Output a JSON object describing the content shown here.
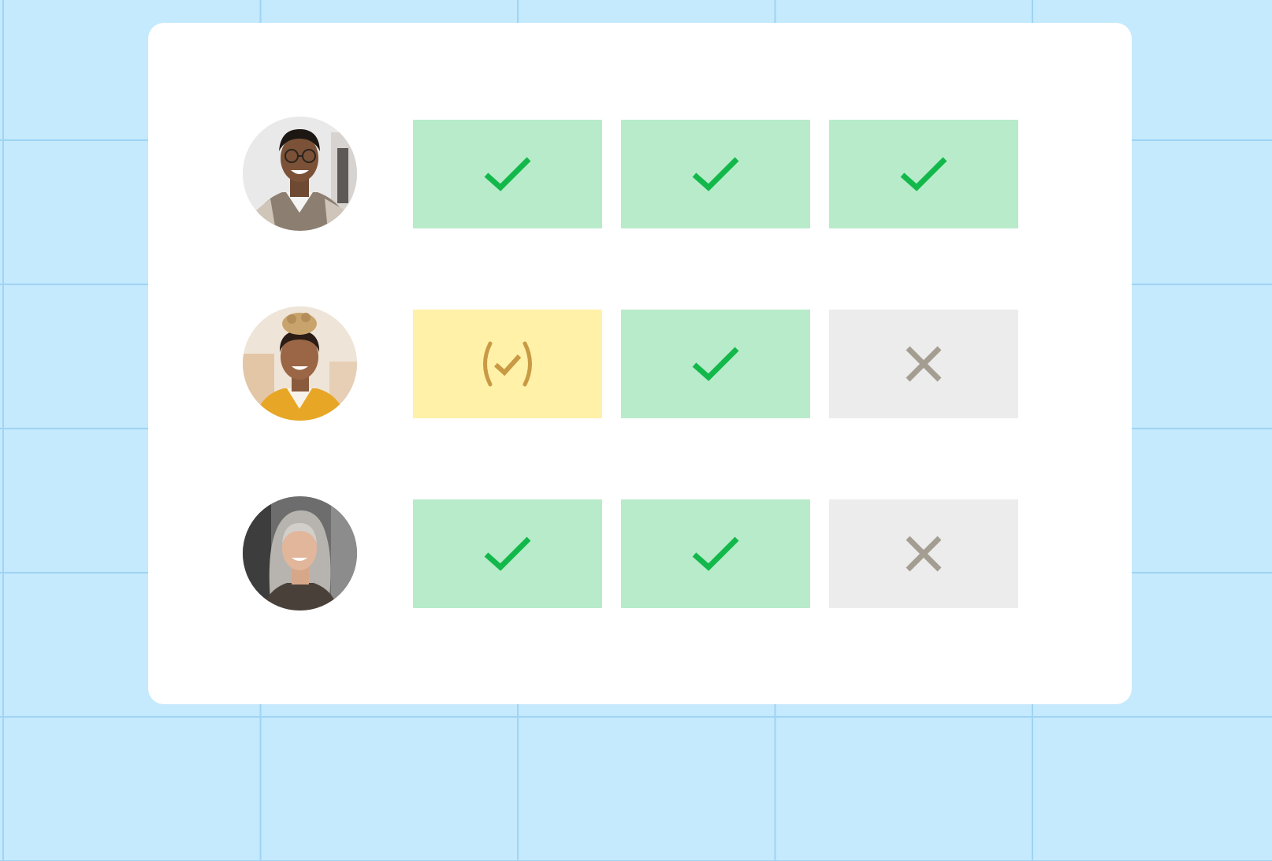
{
  "colors": {
    "background": "#c5e9fd",
    "grid_line": "#9fd4f4",
    "card": "#ffffff",
    "status": {
      "approved": {
        "fill": "#b8ebca",
        "icon": "#12b84a"
      },
      "partial": {
        "fill": "#fff1a8",
        "icon": "#c99a44"
      },
      "rejected": {
        "fill": "#ececec",
        "icon": "#a49d92"
      }
    }
  },
  "people": [
    {
      "avatar": "avatar-young-man-glasses",
      "statuses": [
        "approved",
        "approved",
        "approved"
      ]
    },
    {
      "avatar": "avatar-woman-curly-bun",
      "statuses": [
        "partial",
        "approved",
        "rejected"
      ]
    },
    {
      "avatar": "avatar-woman-gray-hair",
      "statuses": [
        "approved",
        "approved",
        "rejected"
      ]
    }
  ],
  "icons": {
    "approved": "check-icon",
    "partial": "partial-check-icon",
    "rejected": "x-icon"
  }
}
